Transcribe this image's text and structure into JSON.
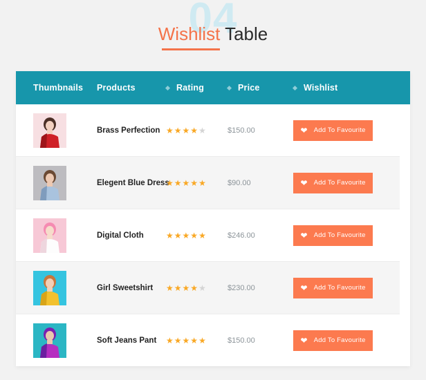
{
  "heading": {
    "background_number": "04",
    "accent_word": "Wishlist",
    "rest_word": " Table",
    "accent_color": "#f4734a",
    "background_number_color": "#cfeaf2"
  },
  "table": {
    "header_bg": "#1796ab",
    "columns": [
      {
        "label": "Thumbnails",
        "sortable": false
      },
      {
        "label": "Products",
        "sortable": false
      },
      {
        "label": "Rating",
        "sortable": true
      },
      {
        "label": "Price",
        "sortable": true
      },
      {
        "label": "Wishlist",
        "sortable": true
      }
    ],
    "button_color": "#fc7a4f",
    "star_on_color": "#f9a825",
    "star_off_color": "#d4d4d4",
    "rows": [
      {
        "name": "Brass Perfection",
        "rating": 4,
        "max_rating": 5,
        "price": "$150.00",
        "action_label": "Add To Favourite",
        "thumb": {
          "bg": "#f7dfe2",
          "garment": "#cf2027",
          "garment_dark": "#9e1419",
          "skin": "#f3d0c0",
          "hair": "#4b2f26"
        }
      },
      {
        "name": "Elegent Blue Dress",
        "rating": 5,
        "max_rating": 5,
        "price": "$90.00",
        "action_label": "Add To Favourite",
        "thumb": {
          "bg": "#bdbcc0",
          "garment": "#a9c3de",
          "garment_dark": "#7f9cbd",
          "skin": "#edc9b2",
          "hair": "#6b4a33"
        }
      },
      {
        "name": "Digital Cloth",
        "rating": 5,
        "max_rating": 5,
        "price": "$246.00",
        "action_label": "Add To Favourite",
        "thumb": {
          "bg": "#f7c8d6",
          "garment": "#fdfdfd",
          "garment_dark": "#eed6de",
          "skin": "#f6dccb",
          "hair": "#f58bb2"
        }
      },
      {
        "name": "Girl Sweetshirt",
        "rating": 4,
        "max_rating": 5,
        "price": "$230.00",
        "action_label": "Add To Favourite",
        "thumb": {
          "bg": "#35c4e0",
          "garment": "#f2c12e",
          "garment_dark": "#d8a418",
          "skin": "#f3cfb6",
          "hair": "#c9763c"
        }
      },
      {
        "name": "Soft Jeans Pant",
        "rating": 5,
        "max_rating": 5,
        "price": "$150.00",
        "action_label": "Add To Favourite",
        "thumb": {
          "bg": "#2bb6c4",
          "garment": "#b52ec0",
          "garment_dark": "#6c1fa0",
          "skin": "#eac7ad",
          "hair": "#7a1fb0"
        }
      }
    ]
  }
}
